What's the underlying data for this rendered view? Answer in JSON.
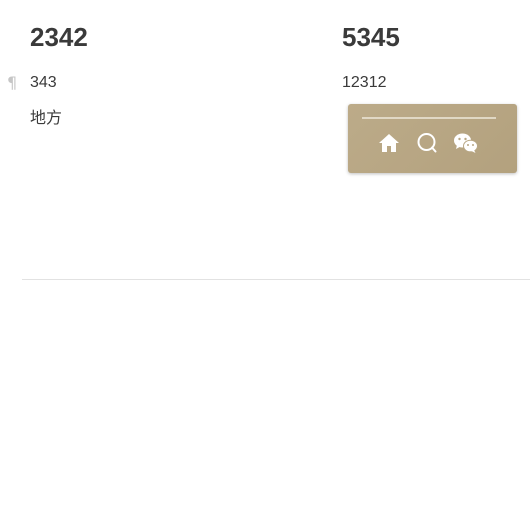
{
  "editor": {
    "left": {
      "heading": "2342",
      "paragraph_1": "343",
      "paragraph_2": "地方"
    },
    "right": {
      "heading": "5345",
      "paragraph_1": "12312"
    },
    "pilcrow": "¶"
  },
  "toolbar": {
    "background_color": "#b8a785",
    "icon_color": "#ffffff",
    "buttons": [
      {
        "icon": "home-icon"
      },
      {
        "icon": "search-icon"
      },
      {
        "icon": "wechat-icon"
      }
    ]
  }
}
